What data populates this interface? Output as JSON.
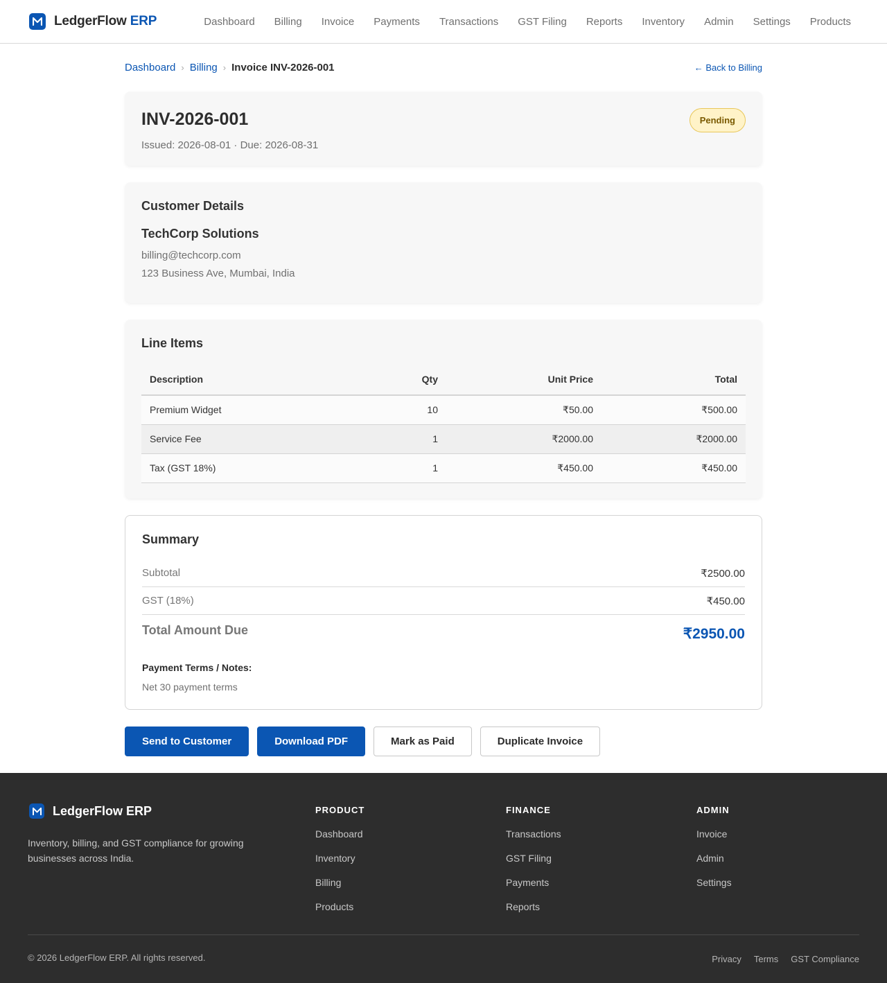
{
  "brand": {
    "name": "LedgerFlow",
    "accent": "ERP",
    "logo_letter": "M"
  },
  "nav": [
    "Dashboard",
    "Billing",
    "Invoice",
    "Payments",
    "Transactions",
    "GST Filing",
    "Reports",
    "Inventory",
    "Admin",
    "Settings",
    "Products"
  ],
  "breadcrumb": {
    "home": "Dashboard",
    "section": "Billing",
    "current": "Invoice INV-2026-001"
  },
  "back_link": "← Back to Billing",
  "invoice": {
    "number": "INV-2026-001",
    "meta": "Issued: 2026-08-01 · Due: 2026-08-31",
    "status": "Pending"
  },
  "customer": {
    "title": "Customer Details",
    "name": "TechCorp Solutions",
    "email": "billing@techcorp.com",
    "address": "123 Business Ave, Mumbai, India"
  },
  "line_items": {
    "title": "Line Items",
    "headers": {
      "description": "Description",
      "qty": "Qty",
      "unit_price": "Unit Price",
      "total": "Total"
    },
    "rows": [
      {
        "description": "Premium Widget",
        "qty": "10",
        "unit_price": "₹50.00",
        "total": "₹500.00"
      },
      {
        "description": "Service Fee",
        "qty": "1",
        "unit_price": "₹2000.00",
        "total": "₹2000.00"
      },
      {
        "description": "Tax (GST 18%)",
        "qty": "1",
        "unit_price": "₹450.00",
        "total": "₹450.00"
      }
    ]
  },
  "summary": {
    "title": "Summary",
    "subtotal_label": "Subtotal",
    "subtotal": "₹2500.00",
    "gst_label": "GST (18%)",
    "gst": "₹450.00",
    "total_label": "Total Amount Due",
    "total": "₹2950.00",
    "notes_title": "Payment Terms / Notes:",
    "notes": "Net 30 payment terms"
  },
  "actions": {
    "send": "Send to Customer",
    "download": "Download PDF",
    "mark_paid": "Mark as Paid",
    "duplicate": "Duplicate Invoice"
  },
  "footer": {
    "brand_name": "LedgerFlow ERP",
    "tagline": "Inventory, billing, and GST compliance for growing businesses across India.",
    "columns": [
      {
        "title": "PRODUCT",
        "links": [
          "Dashboard",
          "Inventory",
          "Billing",
          "Products"
        ]
      },
      {
        "title": "FINANCE",
        "links": [
          "Transactions",
          "GST Filing",
          "Payments",
          "Reports"
        ]
      },
      {
        "title": "ADMIN",
        "links": [
          "Invoice",
          "Admin",
          "Settings"
        ]
      }
    ],
    "copyright": "© 2026 LedgerFlow ERP. All rights reserved.",
    "legal": [
      "Privacy",
      "Terms",
      "GST Compliance"
    ]
  },
  "colors": {
    "primary": "#0b56b3",
    "badge_bg": "#fff3c8",
    "badge_text": "#7a5a00",
    "footer_bg": "#2d2d2d"
  }
}
